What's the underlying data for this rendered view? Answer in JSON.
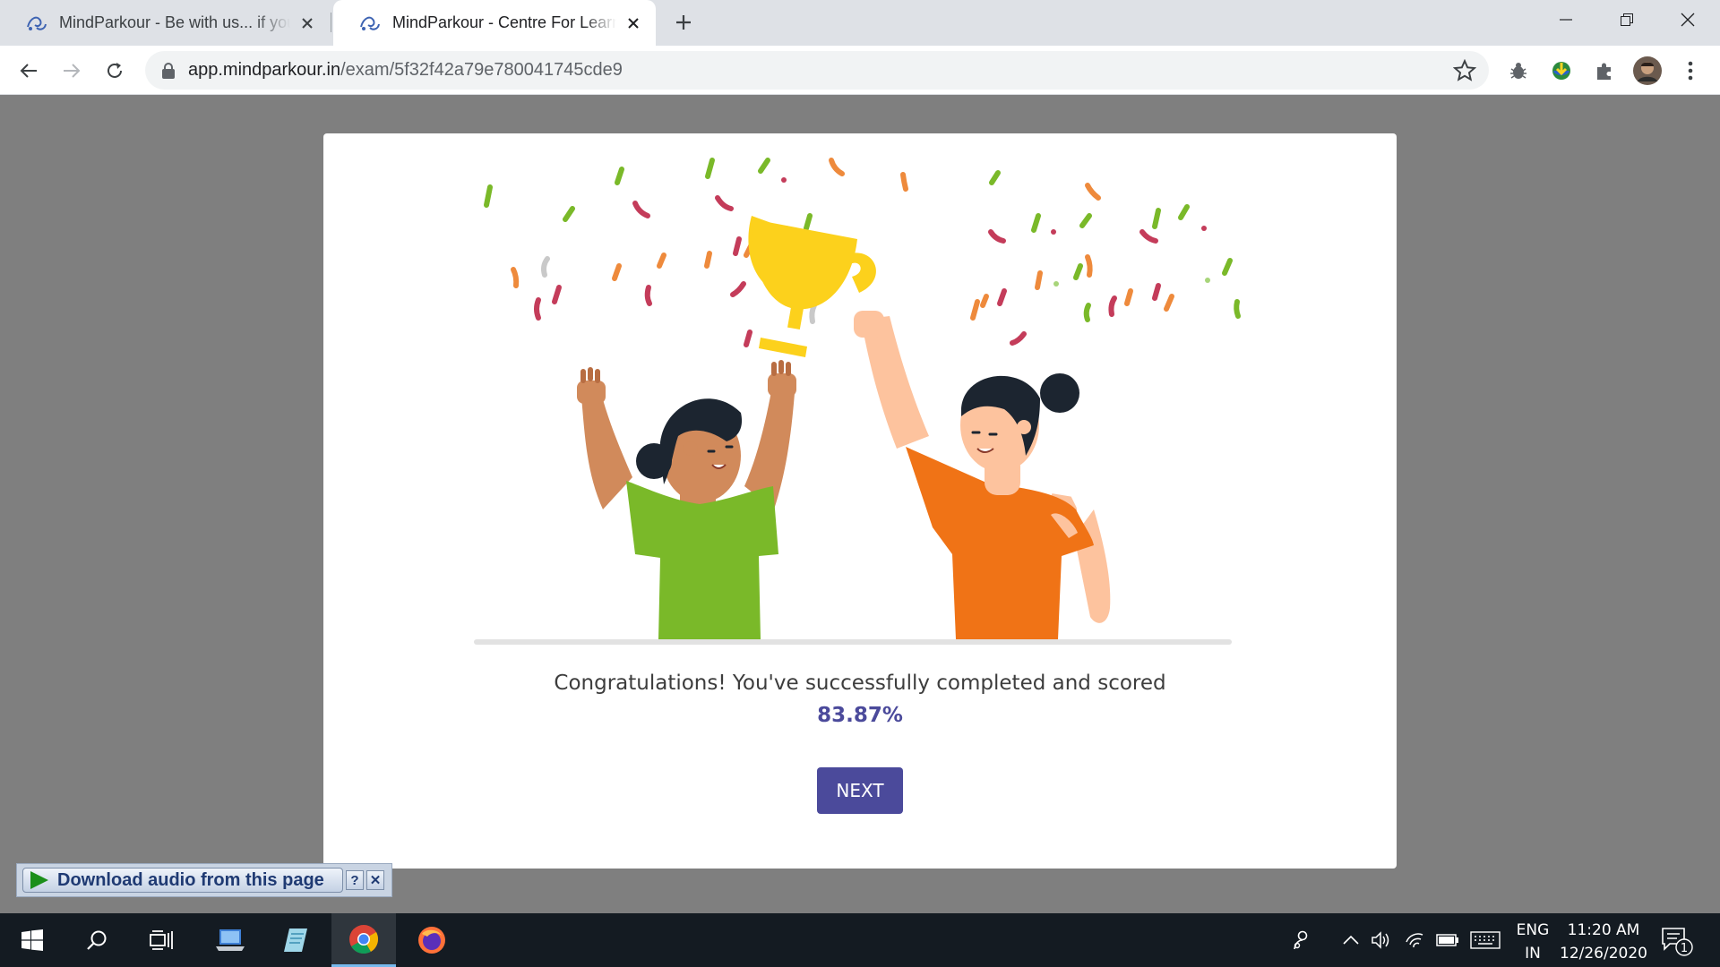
{
  "browser": {
    "tabs": [
      {
        "title": "MindParkour - Be with us... if you can!",
        "active": false
      },
      {
        "title": "MindParkour - Centre For Learning",
        "active": true
      }
    ],
    "address": {
      "host": "app.mindparkour.in",
      "path": "/exam/5f32f42a79e780041745cde9"
    }
  },
  "exam_result": {
    "message": "Congratulations! You've successfully completed and scored",
    "score": "83.87%",
    "next_label": "NEXT"
  },
  "download_bar": {
    "label": "Download audio from this page",
    "help": "?",
    "close": "✕"
  },
  "taskbar": {
    "language_top": "ENG",
    "language_bottom": "IN",
    "time": "11:20 AM",
    "date": "12/26/2020",
    "notification_count": "1"
  },
  "colors": {
    "accent": "#4b4a9b",
    "page_overlay": "#7f7f7f",
    "green_shirt": "#7ab929",
    "orange_shirt": "#f07316",
    "trophy": "#fcd11c"
  }
}
